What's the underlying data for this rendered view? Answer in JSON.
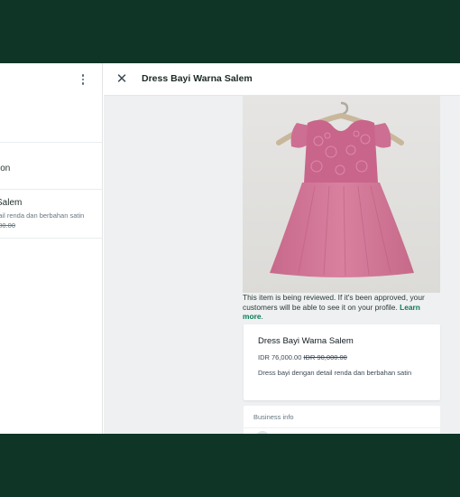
{
  "left_panel": {
    "row1_text": "ion",
    "product_row": {
      "title": "Salem",
      "description": "etail renda dan berbahan satin",
      "old_price": ",000.00"
    }
  },
  "detail": {
    "title": "Dress Bayi Warna Salem",
    "notice_text": "This item is being reviewed. If it's been approved, your customers will be able to see it on your profile. ",
    "learn_more": "Learn more",
    "notice_end": ".",
    "product": {
      "name": "Dress Bayi Warna Salem",
      "price": "IDR 76,000.00",
      "old_price": "IDR 90,000.00",
      "description": "Dress bayi dengan detail renda dan berbahan satin"
    },
    "business_info_label": "Business info"
  },
  "colors": {
    "backdrop": "#0f3526",
    "accent": "#0b7a54",
    "dress_pink": "#d47a99"
  }
}
